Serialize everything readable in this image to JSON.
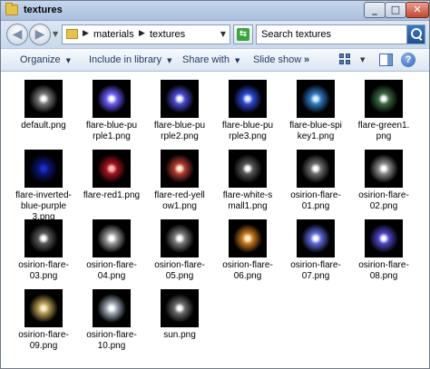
{
  "window": {
    "title": "textures"
  },
  "titlebar_buttons": {
    "minimize": "_",
    "maximize": "□",
    "close": "✕"
  },
  "nav": {
    "back_glyph": "◀",
    "forward_glyph": "▶",
    "breadcrumb": [
      "materials",
      "textures"
    ],
    "search_placeholder": "Search textures"
  },
  "toolbar": {
    "organize": "Organize",
    "include_in_library": "Include in library",
    "share_with": "Share with",
    "slide_show": "Slide show",
    "more": "»"
  },
  "files": [
    {
      "name": "default.png",
      "glow": "#ffffff",
      "halo": "#777777"
    },
    {
      "name": "flare-blue-pu rple1.png",
      "glow": "#ffffff",
      "halo": "#6a5cff"
    },
    {
      "name": "flare-blue-pu rple2.png",
      "glow": "#ffffff",
      "halo": "#4a4ad6"
    },
    {
      "name": "flare-blue-pu rple3.png",
      "glow": "#e9f0ff",
      "halo": "#2c47d8"
    },
    {
      "name": "flare-blue-spi key1.png",
      "glow": "#dff2ff",
      "halo": "#2f79c4"
    },
    {
      "name": "flare-green1. png",
      "glow": "#ffffff",
      "halo": "#3a6a40"
    },
    {
      "name": "flare-inverte d-blue-purple 3.png",
      "glow": "#1a2fd0",
      "halo": "#0a1577"
    },
    {
      "name": "flare-red1.pn g",
      "glow": "#ffc0c0",
      "halo": "#a5121e"
    },
    {
      "name": "flare-red-yell ow1.png",
      "glow": "#fff0d6",
      "halo": "#b23a32"
    },
    {
      "name": "flare-white-s mall1.png",
      "glow": "#ffffff",
      "halo": "#555555"
    },
    {
      "name": "osirion-flare- 01.png",
      "glow": "#ffffff",
      "halo": "#6d6d6d"
    },
    {
      "name": "osirion-flare- 02.png",
      "glow": "#ffffff",
      "halo": "#8a8a8a"
    },
    {
      "name": "osirion-flare- 03.png",
      "glow": "#ffffff",
      "halo": "#5a5a5a"
    },
    {
      "name": "osirion-flare- 04.png",
      "glow": "#ffffff",
      "halo": "#9a9a9a"
    },
    {
      "name": "osirion-flare- 05.png",
      "glow": "#ffffff",
      "halo": "#7a7a7a"
    },
    {
      "name": "osirion-flare- 06.png",
      "glow": "#fff3d2",
      "halo": "#c97a1d"
    },
    {
      "name": "osirion-flare- 07.png",
      "glow": "#ffffff",
      "halo": "#5d6be0"
    },
    {
      "name": "osirion-flare- 08.png",
      "glow": "#ffffff",
      "halo": "#4d47c9"
    },
    {
      "name": "osirion-flare- 09.png",
      "glow": "#f8efcf",
      "halo": "#b59a52"
    },
    {
      "name": "osirion-flare- 10.png",
      "glow": "#ffffff",
      "halo": "#9ea6b4"
    },
    {
      "name": "sun.png",
      "glow": "#ffffff",
      "halo": "#6b6b6b"
    }
  ]
}
